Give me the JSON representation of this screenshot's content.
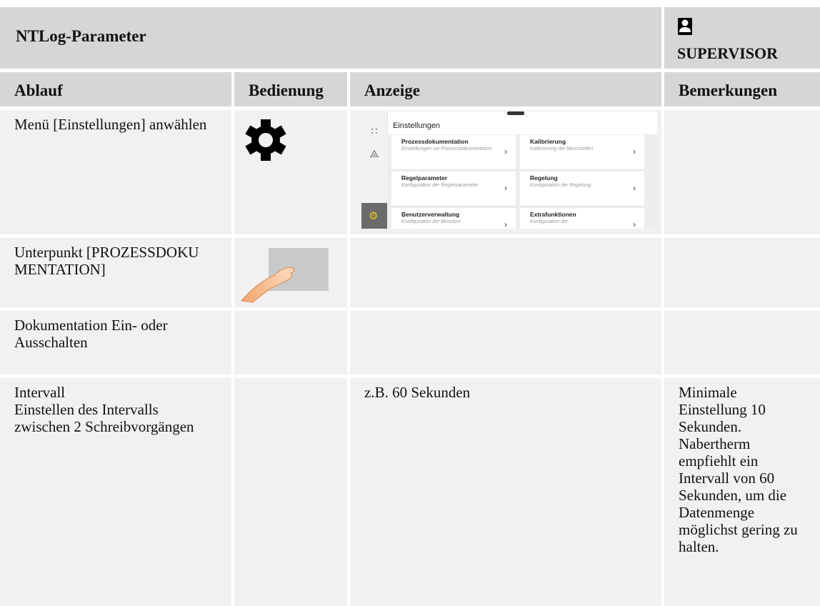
{
  "header": {
    "title": "NTLog-Parameter",
    "role_icon": "person-icon",
    "role": "SUPERVISOR"
  },
  "columns": [
    "Ablauf",
    "Bedienung",
    "Anzeige",
    "Bemerkungen"
  ],
  "rows": [
    {
      "ablauf": "Menü [Einstellungen] anwählen",
      "bedienung_icon": "gear-icon",
      "anzeige": "",
      "bemerkungen": ""
    },
    {
      "ablauf": "Unterpunkt [PROZESSDOKUMENTATION]",
      "bedienung_icon": "finger-touch-icon",
      "anzeige": "",
      "bemerkungen": ""
    },
    {
      "ablauf": "Dokumentation Ein- oder Ausschalten",
      "bedienung_icon": "",
      "anzeige": "",
      "bemerkungen": ""
    },
    {
      "ablauf": "Intervall\nEinstellen des Intervalls zwischen 2 Schreibvorgängen",
      "bedienung_icon": "",
      "anzeige": "z.B. 60 Sekunden",
      "bemerkungen": "Minimale Einstellung 10 Sekunden. Nabertherm empfiehlt ein Intervall von 60 Sekunden, um die Datenmenge möglichst gering zu halten."
    }
  ],
  "screen": {
    "title": "Einstellungen",
    "rail_icons": [
      "grid-icon",
      "chart-icon",
      "gear-icon"
    ],
    "tiles": [
      {
        "title": "Prozessdokumentation",
        "subtitle": "Einstellungen zur Prozessdokumentation"
      },
      {
        "title": "Kalibrierung",
        "subtitle": "Kalibrierung der Messstellen"
      },
      {
        "title": "Regelparameter",
        "subtitle": "Konfiguration der Reglerparameter"
      },
      {
        "title": "Regelung",
        "subtitle": "Konfiguration der Regelung"
      },
      {
        "title": "Benutzerverwaltung",
        "subtitle": "Konfiguration der Benutzer"
      },
      {
        "title": "Extrafunktionen",
        "subtitle": "Konfiguration der"
      }
    ]
  }
}
